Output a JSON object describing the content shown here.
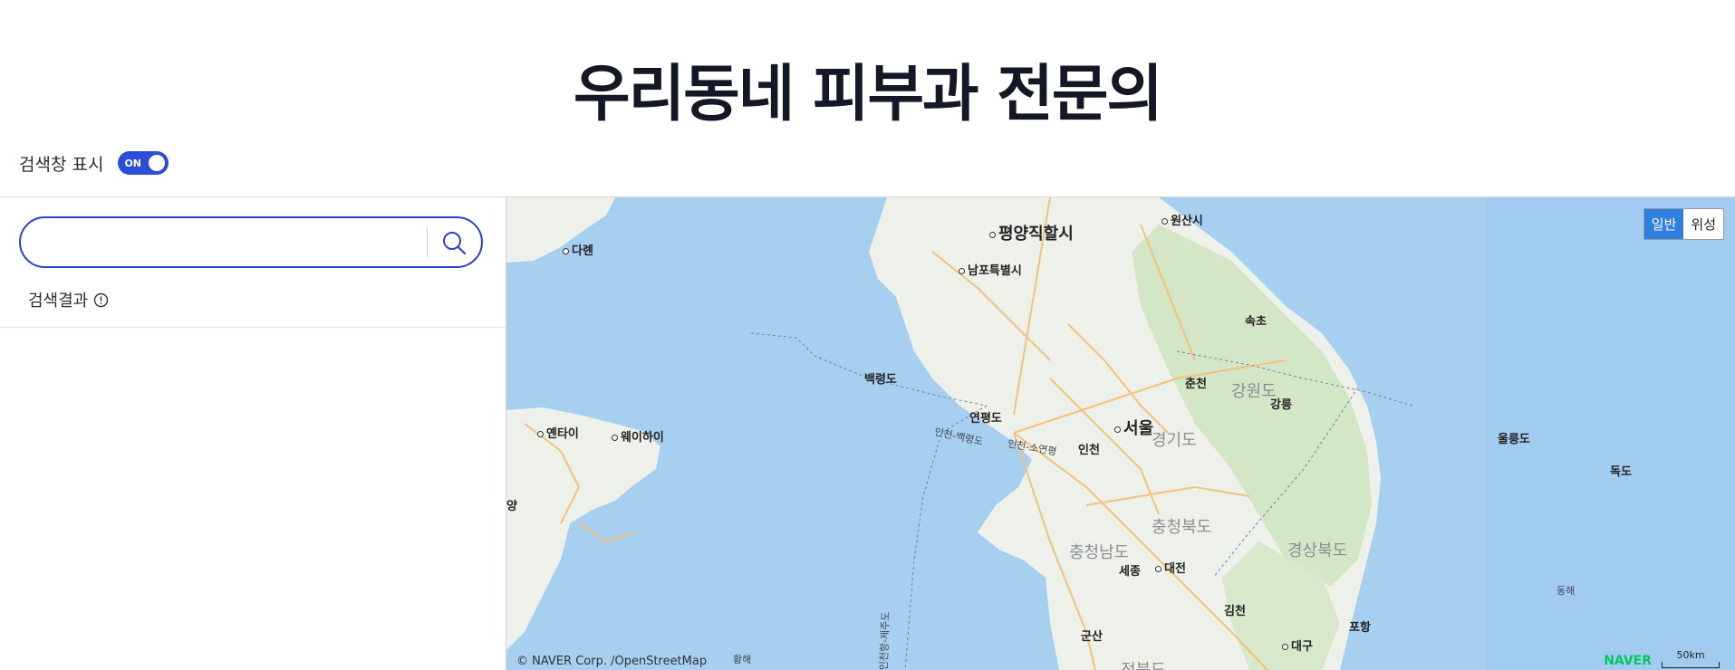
{
  "page": {
    "title": "우리동네 피부과 전문의"
  },
  "toggle": {
    "label": "검색창 표시",
    "state": "ON"
  },
  "search": {
    "value": "",
    "placeholder": "",
    "button_icon": "search-icon"
  },
  "results": {
    "title": "검색결과",
    "info_icon": "info-icon"
  },
  "map": {
    "type_buttons": [
      "일반",
      "위성"
    ],
    "active_type": "일반",
    "labels": {
      "pyongyang": "평양직할시",
      "wonsan": "원산시",
      "dalian": "다롄",
      "nampo": "남포특별시",
      "sokcho": "속초",
      "baengnyeong": "백령도",
      "chuncheon": "춘천",
      "gangwon": "강원도",
      "gangneung": "강릉",
      "yeonpyeong": "연평도",
      "seoul": "서울",
      "ulleung": "울릉도",
      "yantai": "옌타이",
      "weihai": "웨이하이",
      "route1": "인천-백령도",
      "route2": "인천-소연평",
      "incheon": "인천",
      "gyeonggi": "경기도",
      "dokdo": "독도",
      "chungbuk": "충청북도",
      "chungnam": "충청남도",
      "gyeongbuk": "경상북도",
      "sejong": "세종",
      "daejeon": "대전",
      "donghae": "동해",
      "gimcheon": "김천",
      "route3": "인천항-제주도",
      "pohang": "포항",
      "gunsan": "군산",
      "daegu": "대구",
      "hwanghae": "황해",
      "jeonbuk": "전북도",
      "edge": "양"
    },
    "copyright": "© NAVER Corp. /OpenStreetMap",
    "logo": "NAVER",
    "scale": "50km"
  },
  "colors": {
    "accent": "#2a44c9",
    "toggle_bg": "#2a4fd6",
    "sea": "#a7cff0",
    "land": "#eef0ea",
    "forest": "#d3e6c6",
    "road": "#f2c27e"
  }
}
